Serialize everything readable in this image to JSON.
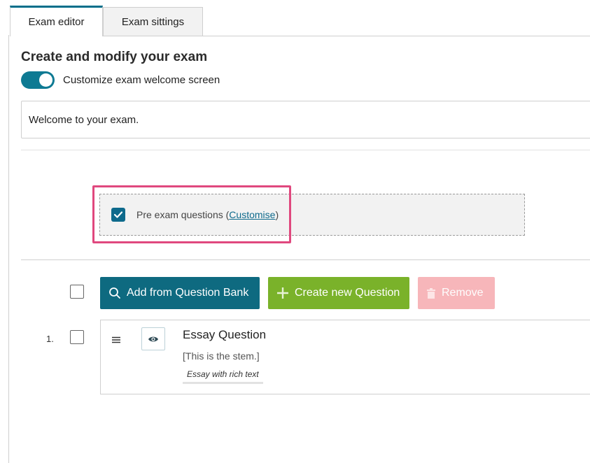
{
  "tabs": [
    {
      "label": "Exam editor",
      "active": true
    },
    {
      "label": "Exam sittings",
      "active": false
    }
  ],
  "editor": {
    "heading": "Create and modify your exam",
    "toggle_label": "Customize exam welcome screen",
    "toggle_on": true,
    "welcome_text": "Welcome to your exam."
  },
  "pre_exam": {
    "checked": true,
    "label": "Pre exam questions",
    "open_paren": "(",
    "link": "Customise",
    "close_paren": ")"
  },
  "toolbar": {
    "add_from_bank": "Add from Question Bank",
    "create_new": "Create new Question",
    "remove": "Remove"
  },
  "questions": [
    {
      "number": "1.",
      "title": "Essay Question",
      "stem": "[This is the stem.]",
      "type": "Essay with rich text"
    }
  ],
  "colors": {
    "accent_teal": "#0e6a80",
    "create_green": "#7ab22a",
    "remove_disabled_pink": "#f7b6ba",
    "highlight_pink": "#e0487e"
  }
}
